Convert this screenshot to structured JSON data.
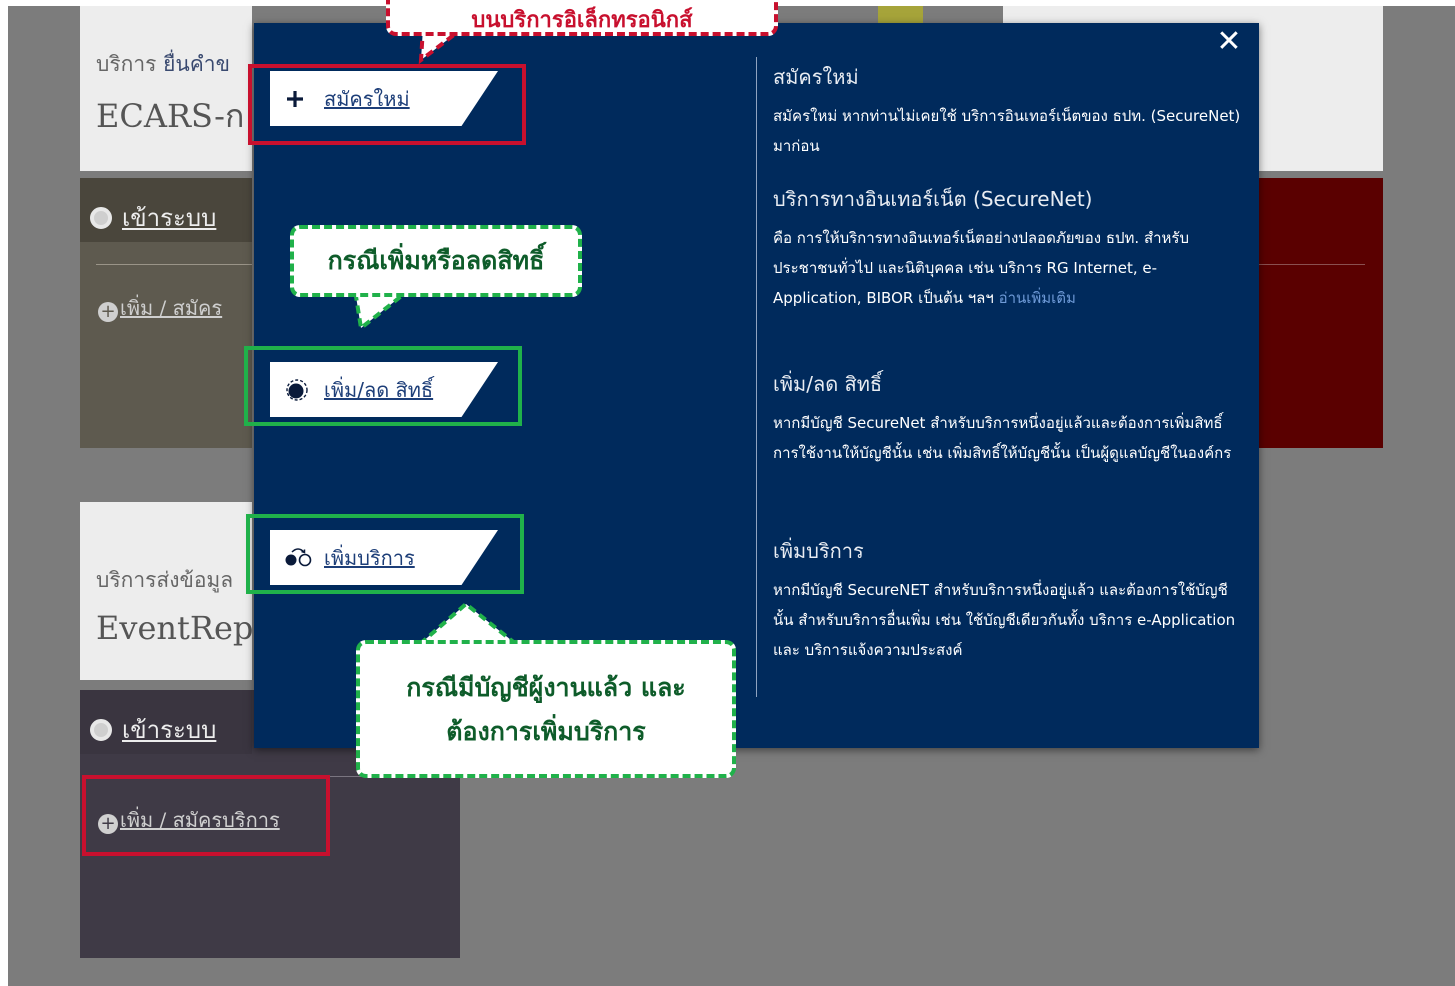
{
  "background": {
    "card1": {
      "prefix": "บริการ ",
      "highlight": "ยื่นคำข",
      "title": "ECARS-ก"
    },
    "login_label": "เข้าระบบ",
    "add_service_label_partial": "เพิ่ม / สมัคร",
    "card2": {
      "prefix": "บริการส่งข้อมูล",
      "title": "EventRep"
    },
    "login_label_2": "เข้าระบบ",
    "add_service_label": "เพิ่ม / สมัครบริการ"
  },
  "modal": {
    "close_glyph": "✕",
    "options": [
      {
        "label": "สมัครใหม่",
        "icon": "plus-icon"
      },
      {
        "label": "เพิ่ม/ลด สิทธิ์",
        "icon": "partial-circle-icon"
      },
      {
        "label": "เพิ่มบริการ",
        "icon": "add-service-icon"
      }
    ],
    "descriptions": {
      "new_title": "สมัครใหม่",
      "new_text": "สมัครใหม่ หากท่านไม่เคยใช้ บริการอินเทอร์เน็ตของ ธปท. (SecureNet) มาก่อน",
      "securenet_title": "บริการทางอินเทอร์เน็ต (SecureNet)",
      "securenet_text": "คือ การให้บริการทางอินเทอร์เน็ตอย่างปลอดภัยของ ธปท. สำหรับประชาชนทั่วไป และนิติบุคคล เช่น บริการ RG Internet, e-Application, BIBOR เป็นต้น ฯลฯ",
      "read_more": "อ่านเพิ่มเติม",
      "rights_title": "เพิ่ม/ลด สิทธิ์",
      "rights_text": "หากมีบัญชี SecureNet สำหรับบริการหนึ่งอยู่แล้วและต้องการเพิ่มสิทธิ์การใช้งานให้บัญชีนั้น เช่น เพิ่มสิทธิ์ให้บัญชีนั้น เป็นผู้ดูแลบัญชีในองค์กร",
      "service_title": "เพิ่มบริการ",
      "service_text": "หากมีบัญชี SecureNET สำหรับบริการหนึ่งอยู่แล้ว และต้องการใช้บัญชีนั้น สำหรับบริการอื่นเพิ่ม เช่น ใช้บัญชีเดียวกันทั้ง บริการ e-Application และ บริการแจ้งความประสงค์"
    }
  },
  "annotations": {
    "red_callout": "บนบริการอิเล็กทรอนิกส์",
    "green_callout_1": "กรณีเพิ่มหรือลดสิทธิ์",
    "green_callout_2_line1": "กรณีมีบัญชีผู้งานแล้ว และ",
    "green_callout_2_line2": "ต้องการเพิ่มบริการ"
  },
  "colors": {
    "modal_bg": "#002a5c",
    "annotation_red": "#c8102e",
    "annotation_green": "#20b14a",
    "link_blue": "#1d3e78"
  }
}
